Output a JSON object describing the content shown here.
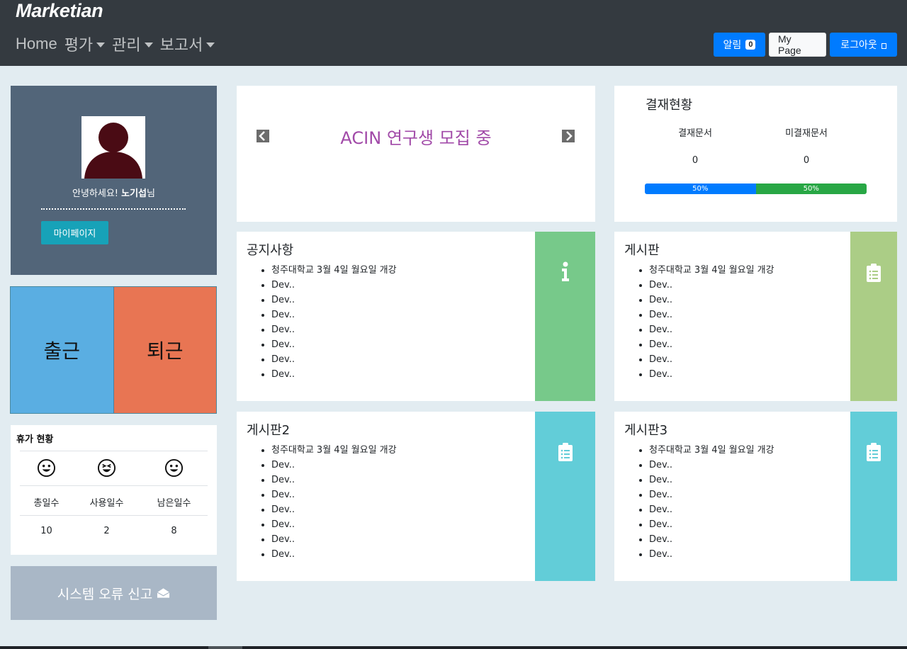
{
  "navbar": {
    "brand": "Marketian",
    "links": [
      {
        "label": "Home",
        "dropdown": false
      },
      {
        "label": "평가",
        "dropdown": true
      },
      {
        "label": "관리",
        "dropdown": true
      },
      {
        "label": "보고서",
        "dropdown": true
      }
    ],
    "alarm_label": "알림",
    "alarm_count": "0",
    "mypage_label": "My Page",
    "logout_label": "로그아웃"
  },
  "profile": {
    "greeting_prefix": "안녕하세요! ",
    "user_name": "노기섭",
    "greeting_suffix": "님",
    "mypage_button": "마이페이지"
  },
  "attendance": {
    "check_in": "출근",
    "check_out": "퇴근"
  },
  "vacation": {
    "title": "휴가 현황",
    "headers": [
      "총일수",
      "사용일수",
      "남은일수"
    ],
    "values": [
      "10",
      "2",
      "8"
    ]
  },
  "report": {
    "label": "시스템 오류 신고"
  },
  "carousel": {
    "text": "ACIN 연구생 모집 중"
  },
  "approval": {
    "title": "결재현황",
    "columns": [
      "결재문서",
      "미결재문서"
    ],
    "values": [
      "0",
      "0"
    ],
    "progress": [
      {
        "label": "50%",
        "value": 50,
        "color": "#007bff"
      },
      {
        "label": "50%",
        "value": 50,
        "color": "#28a745"
      }
    ]
  },
  "boards": [
    {
      "title": "공지사항",
      "icon": "info-icon",
      "color": "#77c98a",
      "items": [
        "청주대학교 3월 4일 월요일 개강",
        "Dev..",
        "Dev..",
        "Dev..",
        "Dev..",
        "Dev..",
        "Dev..",
        "Dev.."
      ]
    },
    {
      "title": "게시판",
      "icon": "clipboard-icon",
      "color": "#abcd86",
      "items": [
        "청주대학교 3월 4일 월요일 개강",
        "Dev..",
        "Dev..",
        "Dev..",
        "Dev..",
        "Dev..",
        "Dev..",
        "Dev.."
      ]
    },
    {
      "title": "게시판2",
      "icon": "clipboard-icon",
      "color": "#62cdd8",
      "items": [
        "청주대학교 3월 4일 월요일 개강",
        "Dev..",
        "Dev..",
        "Dev..",
        "Dev..",
        "Dev..",
        "Dev..",
        "Dev.."
      ]
    },
    {
      "title": "게시판3",
      "icon": "clipboard-icon",
      "color": "#62cdd8",
      "items": [
        "청주대학교 3월 4일 월요일 개강",
        "Dev..",
        "Dev..",
        "Dev..",
        "Dev..",
        "Dev..",
        "Dev..",
        "Dev.."
      ]
    }
  ]
}
